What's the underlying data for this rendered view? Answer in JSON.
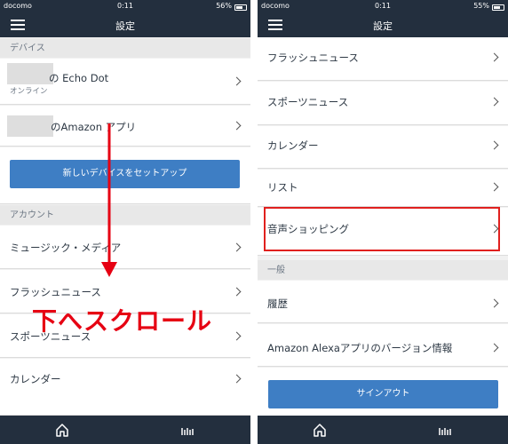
{
  "left": {
    "status": {
      "carrier": "docomo",
      "time": "0:11",
      "battery": "56%"
    },
    "header_title": "設定",
    "sections": {
      "devices": "デバイス",
      "account": "アカウント"
    },
    "devices": [
      {
        "label": "の Echo Dot",
        "sub": "オンライン"
      },
      {
        "label": "のAmazon アプリ"
      }
    ],
    "setup_button": "新しいデバイスをセットアップ",
    "account_items": [
      "ミュージック・メディア",
      "フラッシュニュース",
      "スポーツニュース",
      "カレンダー"
    ],
    "annotation": "下へスクロール"
  },
  "right": {
    "status": {
      "carrier": "docomo",
      "time": "0:11",
      "battery": "55%"
    },
    "header_title": "設定",
    "items": [
      "フラッシュニュース",
      "スポーツニュース",
      "カレンダー",
      "リスト",
      "音声ショッピング"
    ],
    "sections": {
      "general": "一般"
    },
    "general_items": [
      "履歴",
      "Amazon Alexaアプリのバージョン情報"
    ],
    "signout_button": "サインアウト"
  },
  "colors": {
    "header": "#232f3e",
    "button": "#3e7ec4",
    "highlight": "#e0201e",
    "annotation": "#e60012"
  },
  "icons": [
    "hamburger-icon",
    "chevron-right-icon",
    "home-icon",
    "activity-feed-icon",
    "wifi-icon",
    "battery-icon"
  ]
}
